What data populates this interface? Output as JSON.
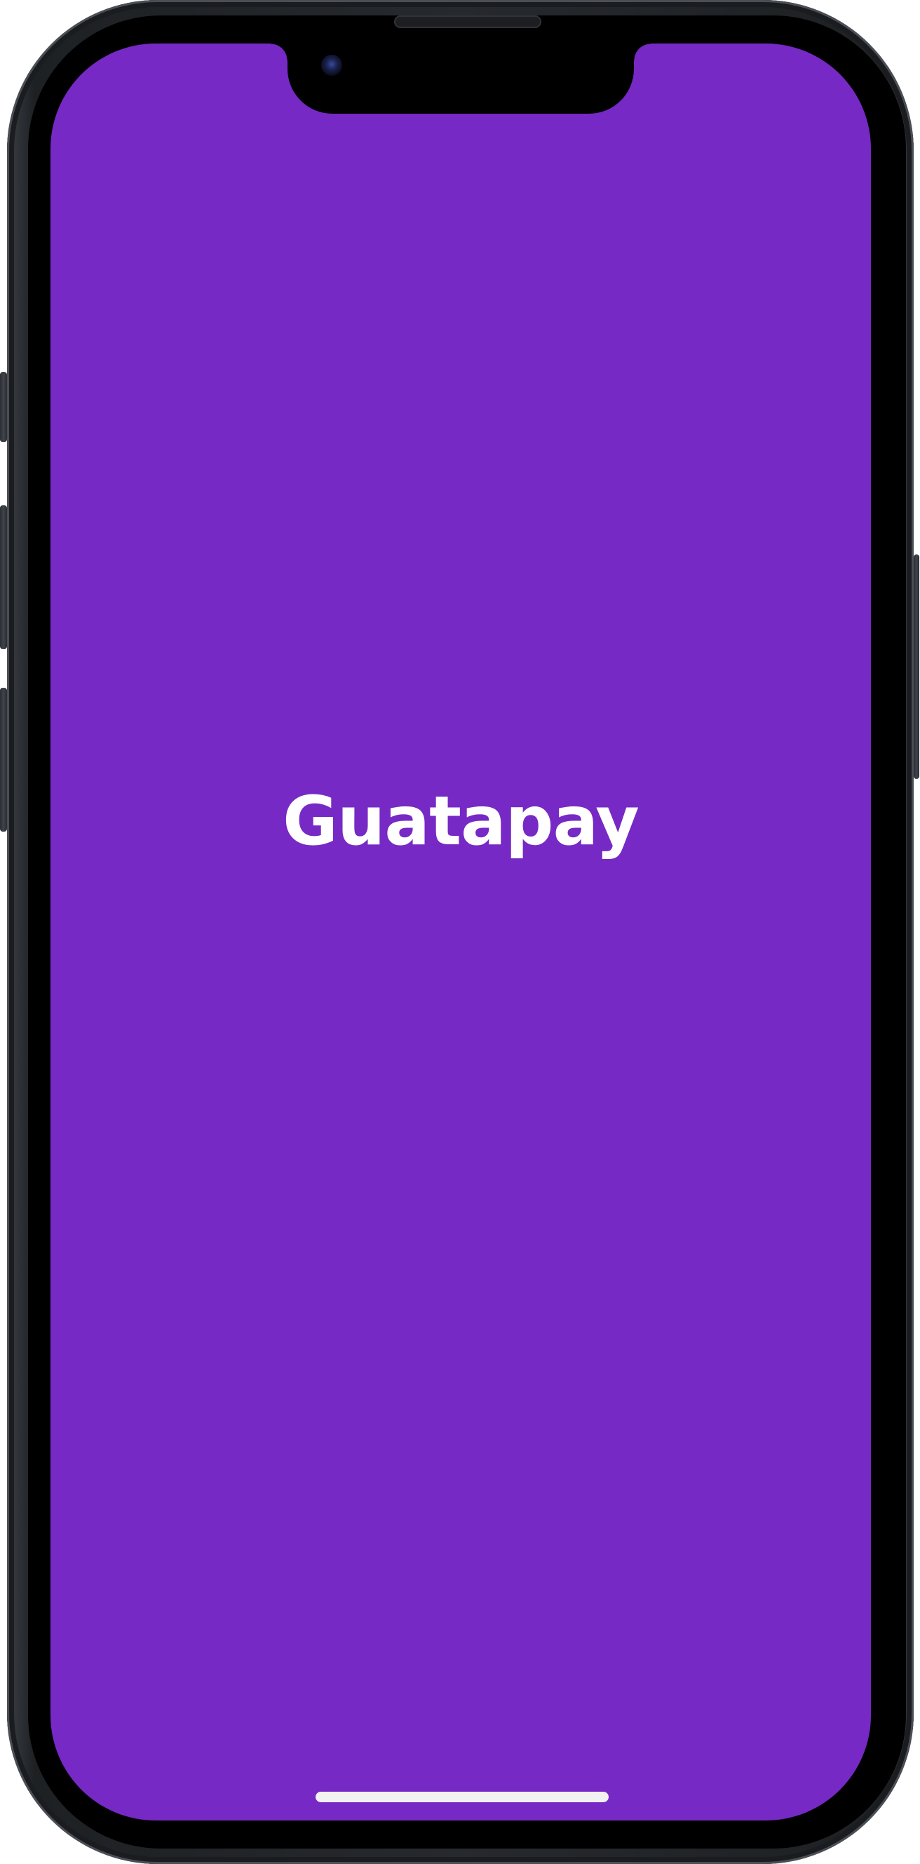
{
  "app": {
    "brand_name": "Guatapay"
  },
  "colors": {
    "background": "#7629c4",
    "brand_text": "#ffffff",
    "home_indicator": "#f2f2f2"
  },
  "icons": {
    "front_camera": "camera-lens-icon",
    "earpiece": "speaker-grille-icon"
  }
}
